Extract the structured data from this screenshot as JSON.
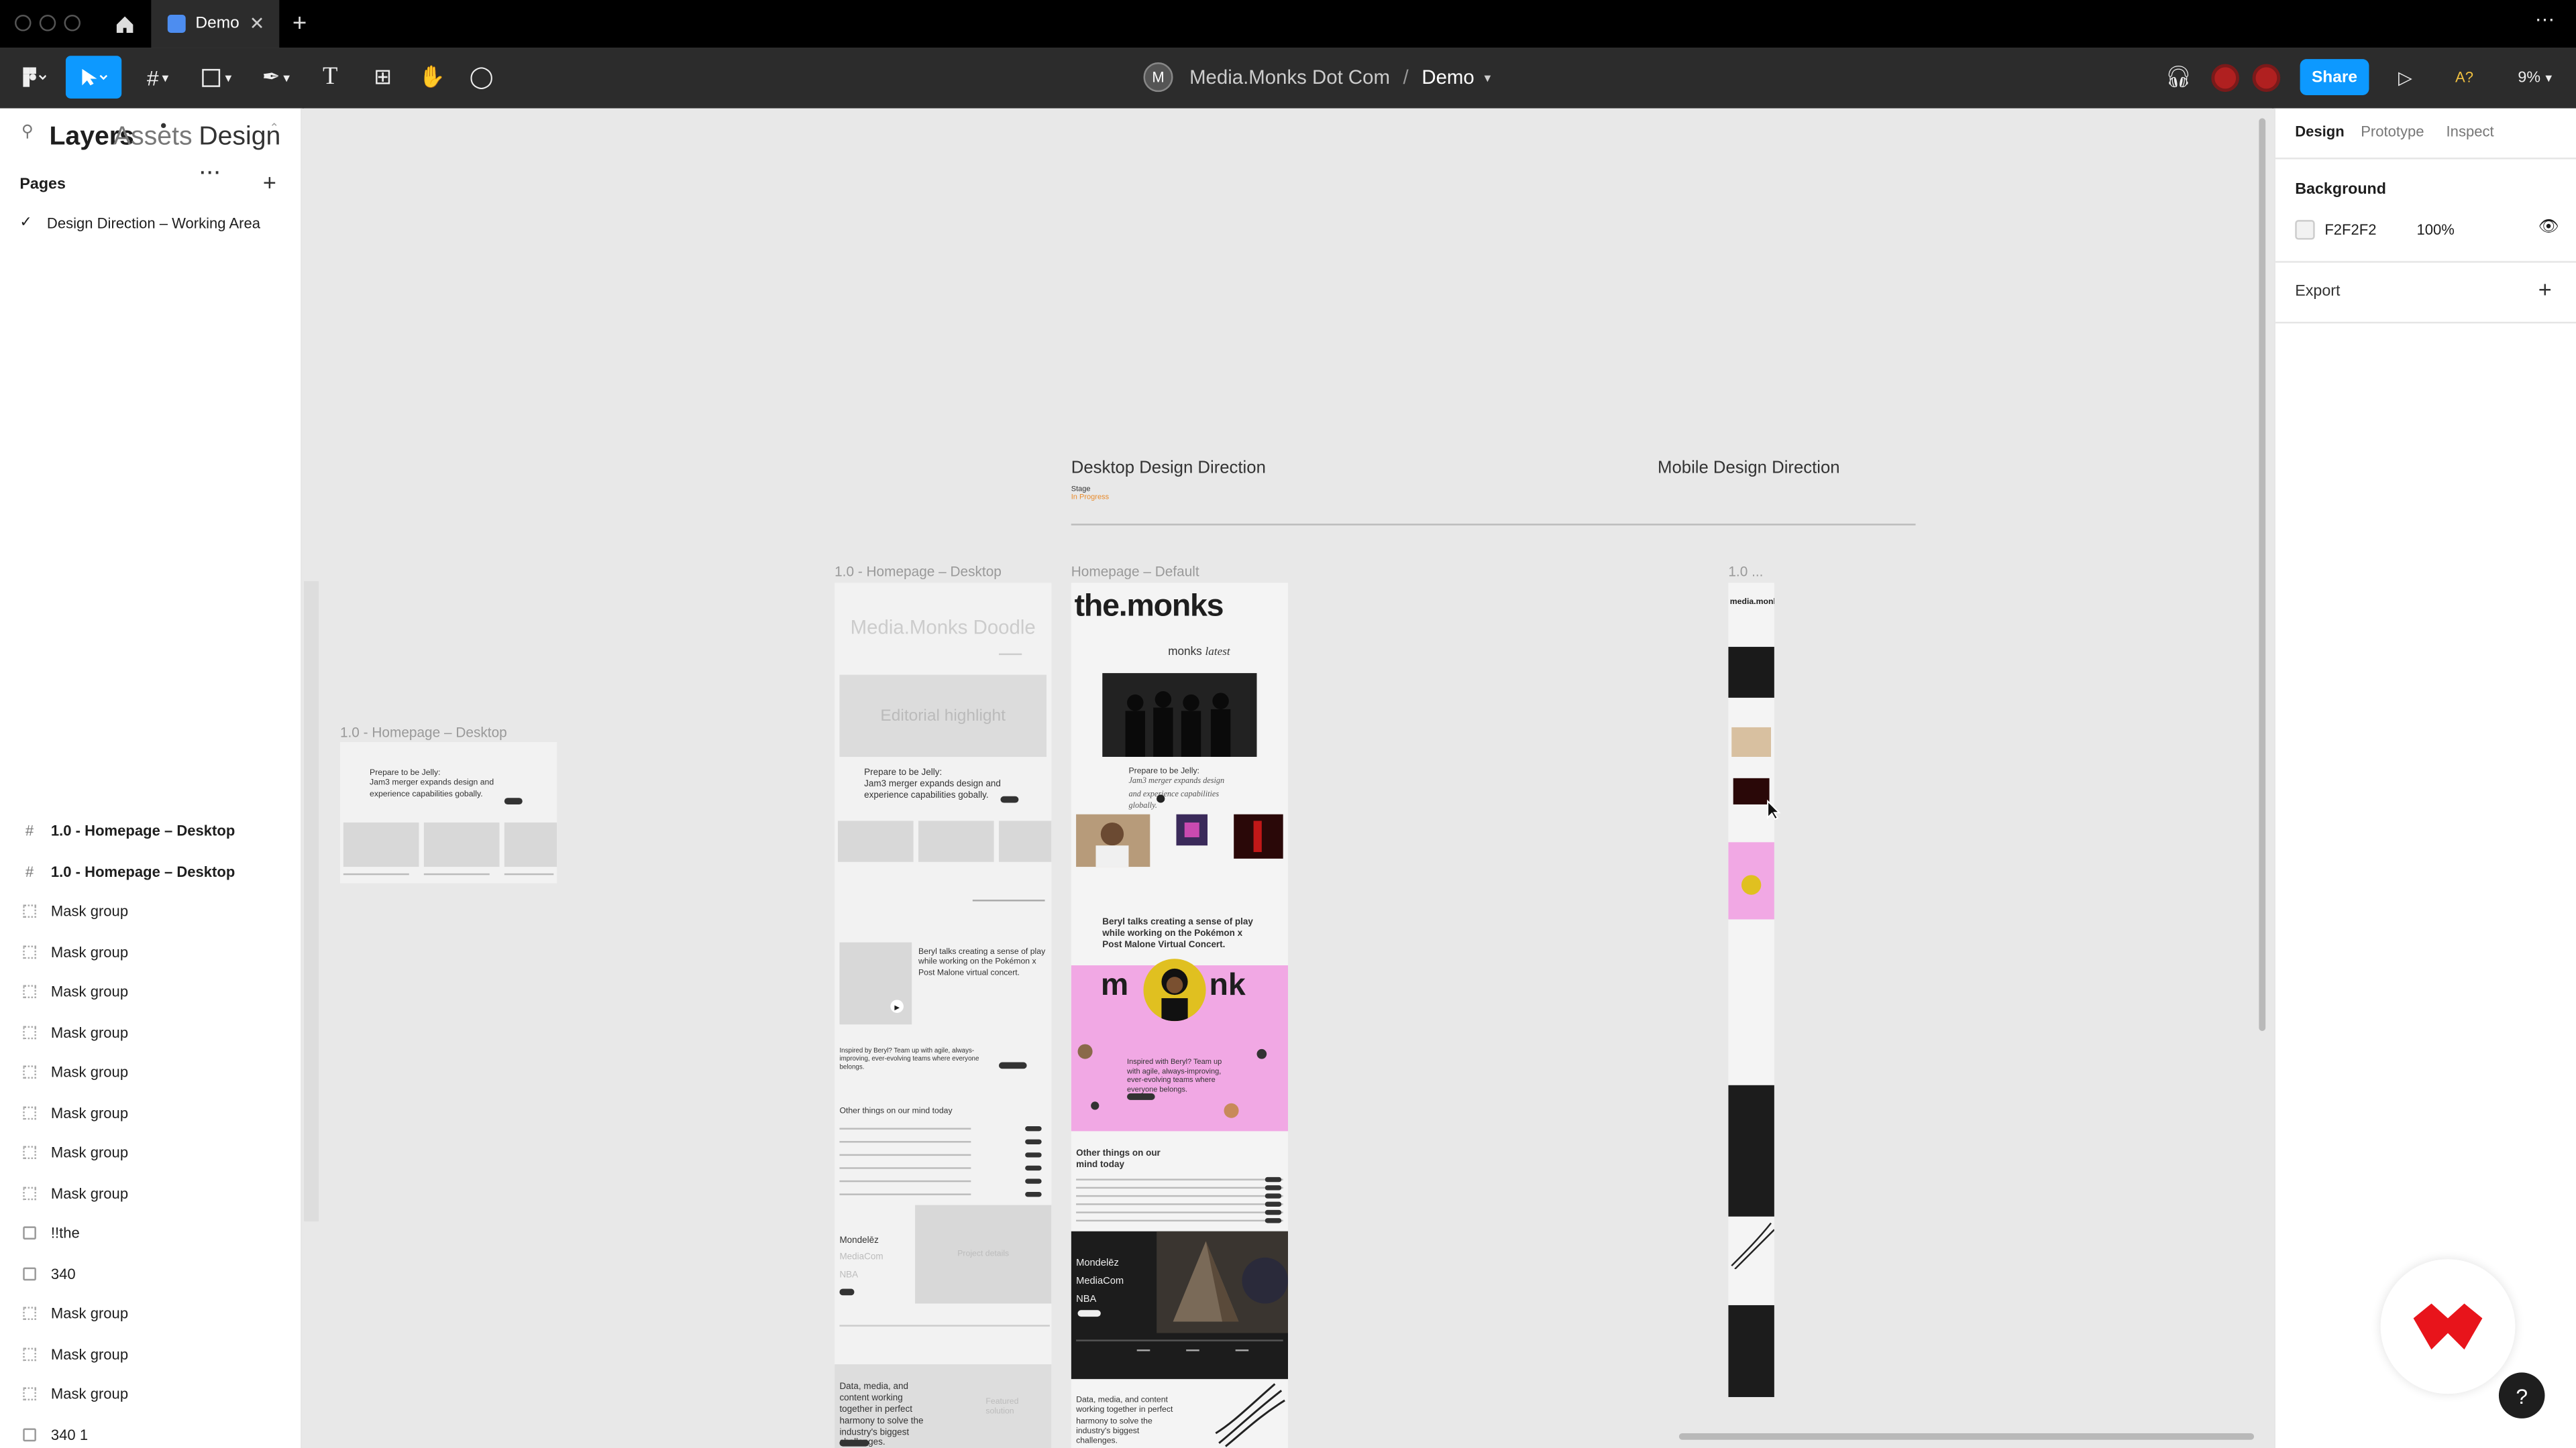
{
  "titlebar": {
    "tab_title": "Demo"
  },
  "toolbar": {
    "team_initial": "M",
    "team": "Media.Monks Dot Com",
    "file": "Demo",
    "share_label": "Share",
    "missing_fonts": "A?",
    "zoom": "9%"
  },
  "left_panel": {
    "tabs": [
      "Layers",
      "Assets",
      "Design ..."
    ],
    "pages_header": "Pages",
    "pages": [
      "Design Direction – Working Area"
    ],
    "layers": [
      {
        "name": "1.0 - Homepage – Desktop",
        "icon": "frame-icon"
      },
      {
        "name": "1.0 - Homepage – Desktop",
        "icon": "frame-icon"
      },
      {
        "name": "Mask group",
        "icon": "mask-group-icon"
      },
      {
        "name": "Mask group",
        "icon": "mask-group-icon"
      },
      {
        "name": "Mask group",
        "icon": "mask-group-icon"
      },
      {
        "name": "Mask group",
        "icon": "mask-group-icon"
      },
      {
        "name": "Mask group",
        "icon": "mask-group-icon"
      },
      {
        "name": "Mask group",
        "icon": "mask-group-icon"
      },
      {
        "name": "Mask group",
        "icon": "mask-group-icon"
      },
      {
        "name": "Mask group",
        "icon": "mask-group-icon"
      },
      {
        "name": "!!the",
        "icon": "image-icon"
      },
      {
        "name": "340",
        "icon": "image-icon"
      },
      {
        "name": "Mask group",
        "icon": "mask-group-icon"
      },
      {
        "name": "Mask group",
        "icon": "mask-group-icon"
      },
      {
        "name": "Mask group",
        "icon": "mask-group-icon"
      },
      {
        "name": "340 1",
        "icon": "image-icon"
      }
    ]
  },
  "right_panel": {
    "tabs": [
      "Design",
      "Prototype",
      "Inspect"
    ],
    "background_label": "Background",
    "background_hex": "F2F2F2",
    "background_opacity": "100%",
    "export_label": "Export"
  },
  "canvas": {
    "desktop_heading": "Desktop Design Direction",
    "stage_label": "Stage",
    "stage_value": "In Progress",
    "mobile_heading": "Mobile Design Direction",
    "frame_labels": [
      "1.0 - Homepage – Desktop",
      "1.0 - Homepage – Desktop",
      "Homepage – Default",
      "1.0 ..."
    ],
    "wire": {
      "prepare": "Prepare to be Jelly:",
      "merger": "Jam3 merger expands design and experience capabilities gobally.",
      "doodle": "Media.Monks Doodle",
      "editorial": "Editorial highlight",
      "beryl": "Beryl talks creating a sense of play while working on the Pokémon x Post Malone virtual concert.",
      "inspired": "Inspired by Beryl? Team up with agile, always-improving, ever-evolving teams where everyone belongs.",
      "other": "Other things on our mind today",
      "clients": [
        "Mondelēz",
        "MediaCom",
        "NBA"
      ],
      "project": "Project details",
      "data_media": "Data, media, and content working together in perfect harmony to solve the industry's biggest challenges.",
      "featured": "Featured solution"
    },
    "monks": {
      "logo": "the.monks",
      "sub": "monks",
      "sub2": "latest",
      "prepare": "Prepare to be Jelly:",
      "merger": "Jam3 merger expands design and experience capabilities globally.",
      "beryl": "Beryl talks creating a sense of play while working on the Pokémon x Post Malone Virtual Concert.",
      "monk_left": "m",
      "monk_right": "nk",
      "inspired": "Inspired with Beryl? Team up with agile, always-improving, ever-evolving teams where everyone belongs.",
      "other": "Other things on our mind today",
      "clients": [
        "Mondelēz",
        "MediaCom",
        "NBA"
      ],
      "data_media": "Data, media, and content working together in perfect harmony to solve the industry's biggest challenges."
    },
    "mobile": {
      "logo": "media.monks"
    }
  },
  "colors": {
    "accent": "#0d99ff",
    "pink": "#f1a8e4",
    "brand_red": "#e8141b",
    "stage": "#e88a2a"
  }
}
